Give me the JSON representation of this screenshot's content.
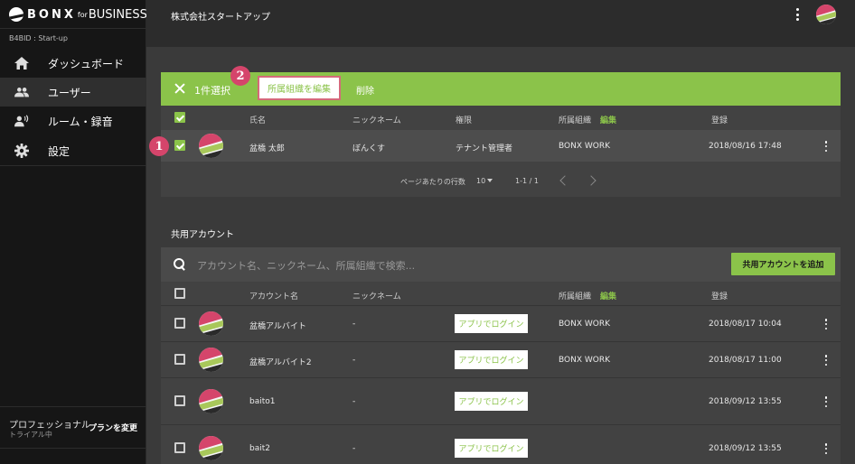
{
  "sidebar": {
    "brand": {
      "mark": "BONX",
      "for": "for",
      "business": "BUSINESS"
    },
    "org_id": "B4BID : Start-up",
    "items": [
      {
        "label": "ダッシュボード",
        "icon": "home-icon"
      },
      {
        "label": "ユーザー",
        "icon": "people-icon"
      },
      {
        "label": "ルーム・録音",
        "icon": "voice-icon"
      },
      {
        "label": "設定",
        "icon": "gear-icon"
      }
    ],
    "active_item": "ユーザー",
    "plan": {
      "name": "プロフェッショナル",
      "status": "トライアル中",
      "change": "プランを変更"
    }
  },
  "header": {
    "company": "株式会社スタートアップ",
    "menu_icon": "more-vert-icon"
  },
  "selection_bar": {
    "count_text": "1件選択",
    "edit_org": "所属組織を編集",
    "delete": "削除",
    "markers": [
      "1",
      "2"
    ],
    "color": "#8bc34a"
  },
  "users_table": {
    "headers": {
      "name": "氏名",
      "nickname": "ニックネーム",
      "role": "権限",
      "org": "所属組織",
      "org_edit": "編集",
      "registered": "登録"
    },
    "rows": [
      {
        "name": "盆橋 太郎",
        "nickname": "ぼんくす",
        "role": "テナント管理者",
        "org": "BONX WORK",
        "registered": "2018/08/16 17:48",
        "checked": true
      }
    ],
    "pagination": {
      "rows_label": "ページあたりの行数",
      "rows_value": "10",
      "range": "1-1 / 1"
    }
  },
  "shared_section": {
    "title": "共用アカウント",
    "search_placeholder": "アカウント名、ニックネーム、所属組織で検索...",
    "add_button": "共用アカウントを追加",
    "headers": {
      "name": "アカウント名",
      "nickname": "ニックネーム",
      "org": "所属組織",
      "org_edit": "編集",
      "registered": "登録"
    },
    "rows": [
      {
        "name": "盆橋アルバイト",
        "nickname": "-",
        "login": "アプリでログイン",
        "org": "BONX WORK",
        "registered": "2018/08/17 10:04"
      },
      {
        "name": "盆橋アルバイト2",
        "nickname": "-",
        "login": "アプリでログイン",
        "org": "BONX WORK",
        "registered": "2018/08/17 11:00"
      },
      {
        "name": "baito1",
        "nickname": "-",
        "login": "アプリでログイン",
        "org": "",
        "registered": "2018/09/12 13:55"
      },
      {
        "name": "bait2",
        "nickname": "-",
        "login": "アプリでログイン",
        "org": "",
        "registered": "2018/09/12 13:55"
      }
    ]
  },
  "colors": {
    "accent": "#8bc34a",
    "marker": "#d5456b",
    "sidebar": "#161616",
    "content": "#3a3a3a"
  }
}
